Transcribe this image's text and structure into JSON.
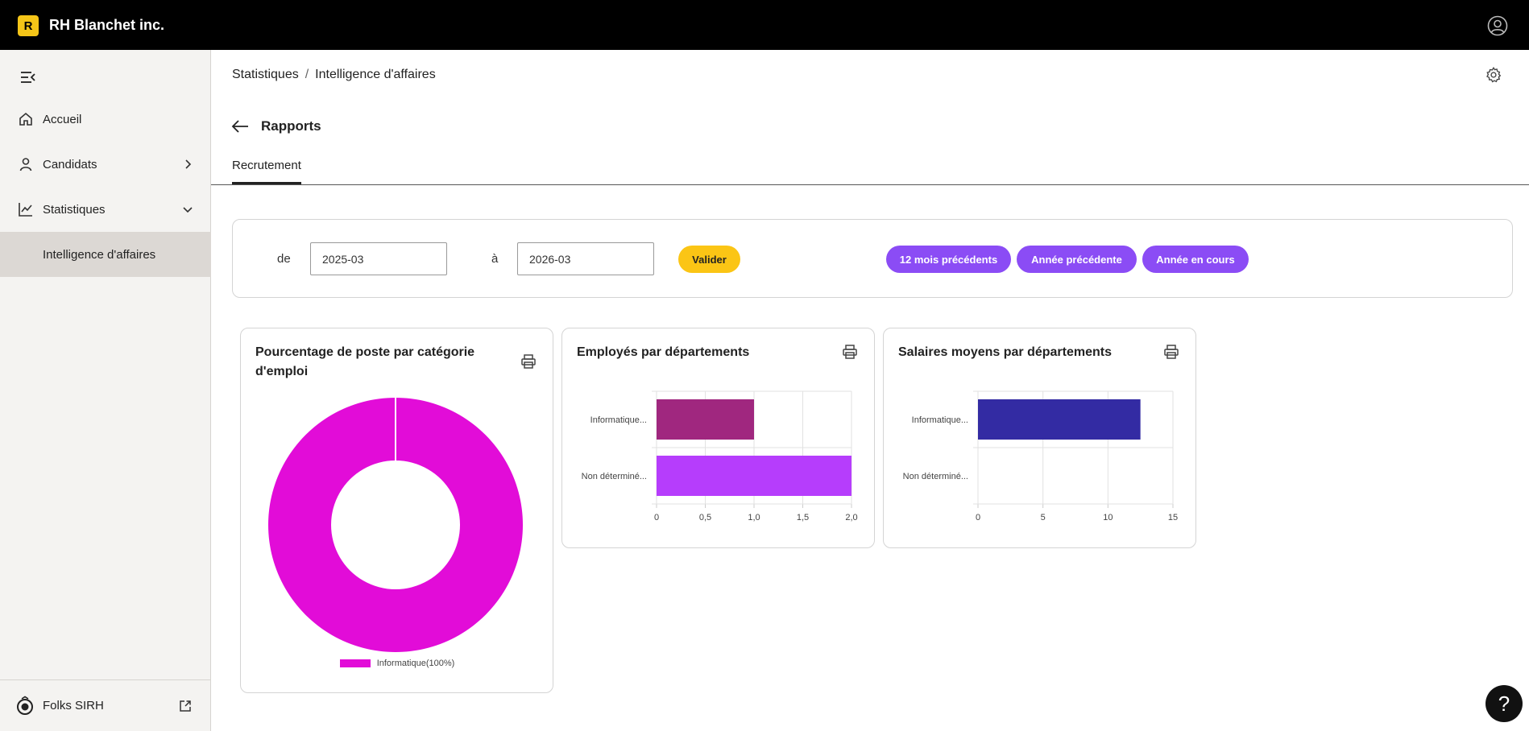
{
  "app": {
    "logo_letter": "R",
    "company_name": "RH Blanchet inc."
  },
  "sidebar": {
    "items": [
      {
        "label": "Accueil",
        "icon": "home-icon"
      },
      {
        "label": "Candidats",
        "icon": "person-icon"
      },
      {
        "label": "Statistiques",
        "icon": "chart-line-icon"
      }
    ],
    "subitem": {
      "label": "Intelligence d'affaires",
      "active": true
    },
    "footer_label": "Folks SIRH"
  },
  "breadcrumb": {
    "items": [
      "Statistiques",
      "Intelligence d'affaires"
    ],
    "separator": "/"
  },
  "page": {
    "title": "Rapports",
    "tabs": [
      {
        "label": "Recrutement",
        "active": true
      }
    ]
  },
  "filters": {
    "from_label": "de",
    "from_value": "2025-03",
    "to_label": "à",
    "to_value": "2026-03",
    "validate_label": "Valider",
    "presets": [
      "12 mois précédents",
      "Année précédente",
      "Année en cours"
    ]
  },
  "colors": {
    "accent_purple": "#8b4cf5",
    "accent_yellow": "#fbc515",
    "donut": "#e20cd8",
    "bar_dept_1": "#a0277f",
    "bar_dept_2": "#b63dfc",
    "bar_salary": "#332ba3"
  },
  "chart_data": [
    {
      "type": "pie",
      "title": "Pourcentage de poste par catégorie d'emploi",
      "labels": [
        "Informatique"
      ],
      "values": [
        100
      ],
      "legend": [
        "Informatique(100%)"
      ],
      "legend_position": "bottom"
    },
    {
      "type": "bar",
      "orientation": "horizontal",
      "title": "Employés par départements",
      "categories": [
        "Informatique...",
        "Non déterminé..."
      ],
      "values": [
        1,
        2
      ],
      "xlim": [
        0,
        2
      ],
      "xticks": [
        "0",
        "0,5",
        "1,0",
        "1,5",
        "2,0"
      ],
      "grid": true
    },
    {
      "type": "bar",
      "orientation": "horizontal",
      "title": "Salaires moyens par départements",
      "categories": [
        "Informatique...",
        "Non déterminé..."
      ],
      "values": [
        12.5,
        0
      ],
      "xlim": [
        0,
        15
      ],
      "xticks": [
        "0",
        "5",
        "10",
        "15"
      ],
      "grid": true
    }
  ],
  "help": {
    "label": "?"
  }
}
